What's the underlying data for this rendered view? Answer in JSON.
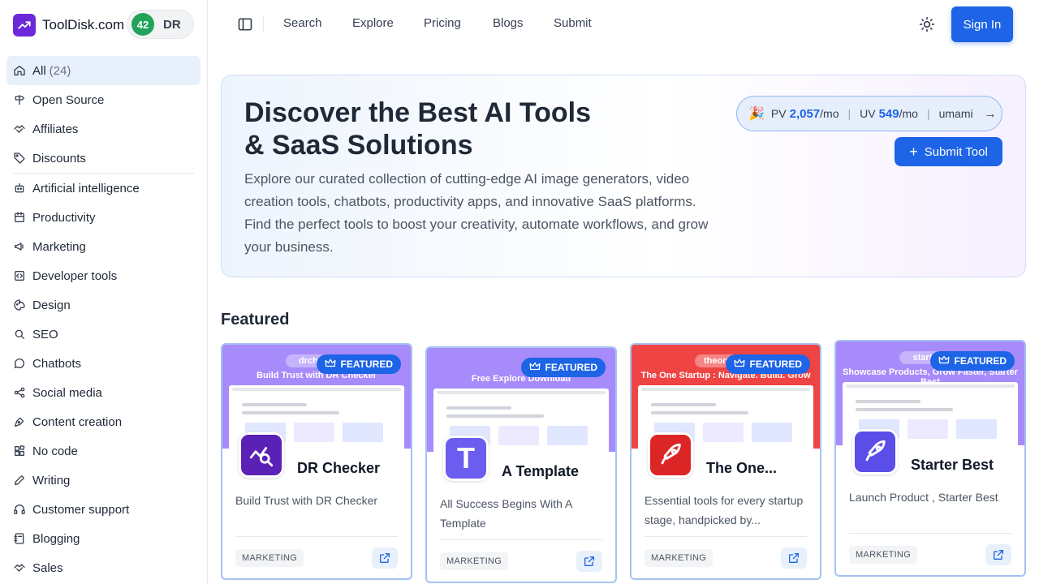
{
  "brand": {
    "name": "ToolDisk.com",
    "dr_value": "42",
    "dr_label": "DR"
  },
  "sidebar": {
    "top_items": [
      {
        "label": "All",
        "count": "(24)",
        "icon": "home-icon"
      },
      {
        "label": "Open Source",
        "icon": "signpost-icon"
      },
      {
        "label": "Affiliates",
        "icon": "handshake-icon"
      },
      {
        "label": "Discounts",
        "icon": "tag-icon"
      }
    ],
    "categories": [
      {
        "label": "Artificial intelligence",
        "icon": "robot-icon"
      },
      {
        "label": "Productivity",
        "icon": "calendar-icon"
      },
      {
        "label": "Marketing",
        "icon": "megaphone-icon"
      },
      {
        "label": "Developer tools",
        "icon": "code-icon"
      },
      {
        "label": "Design",
        "icon": "palette-icon"
      },
      {
        "label": "SEO",
        "icon": "search-icon"
      },
      {
        "label": "Chatbots",
        "icon": "chat-icon"
      },
      {
        "label": "Social media",
        "icon": "share-icon"
      },
      {
        "label": "Content creation",
        "icon": "pen-tool-icon"
      },
      {
        "label": "No code",
        "icon": "blocks-icon"
      },
      {
        "label": "Writing",
        "icon": "pencil-icon"
      },
      {
        "label": "Customer support",
        "icon": "headset-icon"
      },
      {
        "label": "Blogging",
        "icon": "notebook-icon"
      },
      {
        "label": "Sales",
        "icon": "handshake-icon"
      }
    ]
  },
  "topbar": {
    "links": [
      "Search",
      "Explore",
      "Pricing",
      "Blogs",
      "Submit"
    ],
    "sign_in": "Sign In"
  },
  "hero": {
    "title": "Discover the Best AI Tools & SaaS Solutions",
    "description": "Explore our curated collection of cutting-edge AI image generators, video creation tools, chatbots, productivity apps, and innovative SaaS platforms. Find the perfect tools to boost your creativity, automate workflows, and grow your business.",
    "stats": {
      "pv_label": "PV",
      "pv_value": "2,057",
      "pv_unit": "/mo",
      "uv_label": "UV",
      "uv_value": "549",
      "uv_unit": "/mo",
      "provider": "umami"
    },
    "submit_label": "Submit Tool"
  },
  "featured": {
    "title": "Featured",
    "badge": "FEATURED",
    "cards": [
      {
        "name": "DR Checker",
        "description": "Build Trust with DR Checker",
        "tag": "MARKETING",
        "shot_brand": "drcheck",
        "shot_tagline": "Build Trust with DR Checker",
        "icon_bg": "#5b21b6",
        "shot_bg": "#a78bfa",
        "icon_letter": ""
      },
      {
        "name": "A Template",
        "description": "All Success Begins With A Template",
        "tag": "MARKETING",
        "shot_brand": "",
        "shot_tagline": "Free Explore Download",
        "icon_bg": "#6d5cf0",
        "shot_bg": "#a78bfa",
        "icon_letter": "T"
      },
      {
        "name": "The One...",
        "description": "Essential tools for every startup stage, handpicked by...",
        "tag": "MARKETING",
        "shot_brand": "theonesta",
        "shot_tagline": "The One Startup : Navigate. Build. Grow",
        "icon_bg": "#dc2626",
        "shot_bg": "#ef4444",
        "icon_letter": ""
      },
      {
        "name": "Starter Best",
        "description": "Launch Product , Starter Best",
        "tag": "MARKETING",
        "shot_brand": "starterb",
        "shot_tagline": "Showcase Products, Grow Faster, Starter Best",
        "icon_bg": "#5b4de8",
        "shot_bg": "#a78bfa",
        "icon_letter": ""
      }
    ]
  }
}
